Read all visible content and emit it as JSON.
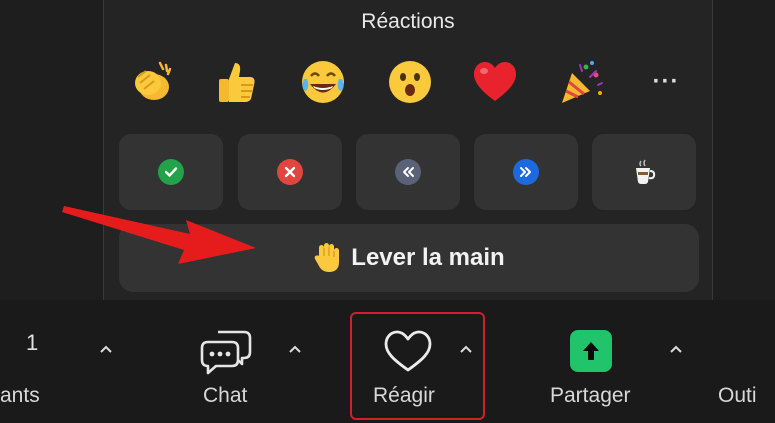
{
  "reactions_panel": {
    "title": "Réactions",
    "emojis": [
      {
        "name": "clapping-hands",
        "symbol": "👏"
      },
      {
        "name": "thumbs-up",
        "symbol": "👍"
      },
      {
        "name": "tears-of-joy",
        "symbol": "😂"
      },
      {
        "name": "surprised",
        "symbol": "😮"
      },
      {
        "name": "heart",
        "symbol": "❤"
      },
      {
        "name": "party-popper",
        "symbol": "🎉"
      }
    ],
    "more_label": "···",
    "status_buttons": [
      {
        "name": "yes",
        "icon": "check-icon",
        "color": "#22a34a"
      },
      {
        "name": "no",
        "icon": "x-icon",
        "color": "#e0453f"
      },
      {
        "name": "slow-down",
        "icon": "rewind-icon",
        "color": "#5a6278"
      },
      {
        "name": "speed-up",
        "icon": "fast-forward-icon",
        "color": "#1d6ae0"
      },
      {
        "name": "coffee",
        "icon": "coffee-cup-icon",
        "color": "#ffffff"
      }
    ],
    "raise_hand": {
      "emoji": "✋",
      "label": "Lever la main"
    }
  },
  "toolbar": {
    "participants_count": "1",
    "participants_label": "ants",
    "chat_label": "Chat",
    "react_label": "Réagir",
    "share_label": "Partager",
    "more_label": "Outi"
  },
  "colors": {
    "share_green": "#21c46a",
    "highlight_red": "#d0202a",
    "arrow_red": "#e61c1c"
  }
}
